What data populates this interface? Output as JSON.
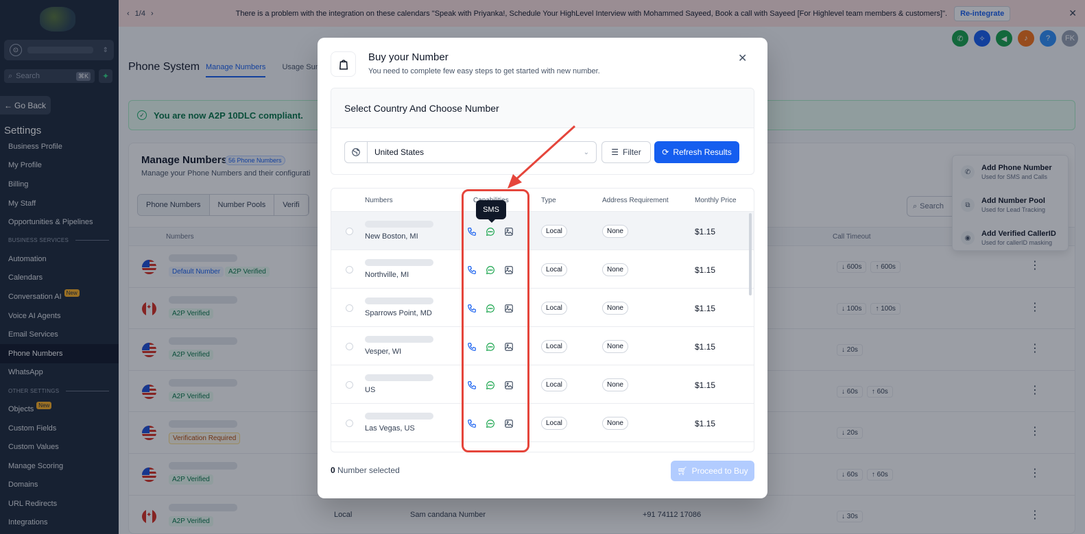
{
  "banner": {
    "pager": "1/4",
    "message": "There is a problem with the integration on these calendars \"Speak with Priyanka!, Schedule Your HighLevel Interview with Mohammed Sayeed, Book a call with Sayeed [For Highlevel team members & customers]\".",
    "button": "Re-integrate"
  },
  "sidebar": {
    "search_placeholder": "Search",
    "search_kbd": "⌘K",
    "go_back": "Go Back",
    "settings_title": "Settings",
    "items_a": [
      "Business Profile",
      "My Profile",
      "Billing",
      "My Staff",
      "Opportunities & Pipelines"
    ],
    "section_business": "BUSINESS SERVICES",
    "items_b": [
      "Automation",
      "Calendars",
      "Conversation AI",
      "Voice AI Agents",
      "Email Services",
      "Phone Numbers",
      "WhatsApp"
    ],
    "section_other": "OTHER SETTINGS",
    "items_c": [
      "Objects",
      "Custom Fields",
      "Custom Values",
      "Manage Scoring",
      "Domains",
      "URL Redirects",
      "Integrations"
    ],
    "new_badge": "New"
  },
  "page": {
    "title": "Phone System",
    "tabs": [
      "Manage Numbers",
      "Usage Sum"
    ],
    "compliant": "You are now A2P 10DLC compliant.",
    "card_title": "Manage Numbers",
    "count_badge": "56 Phone Numbers",
    "card_desc": "Manage your Phone Numbers and their configurati",
    "segments": [
      "Phone Numbers",
      "Number Pools",
      "Verifi"
    ],
    "search_placeholder": "Search",
    "col_numbers": "Numbers",
    "col_timeout": "Call Timeout",
    "tags": {
      "default": "Default Number",
      "a2p": "A2P Verified",
      "verification": "Verification Required"
    },
    "rows": [
      {
        "flag": "us",
        "tags": [
          "default",
          "a2p"
        ],
        "timeout": [
          "↓ 600s",
          "↑ 600s"
        ]
      },
      {
        "flag": "ca",
        "tags": [
          "a2p"
        ],
        "timeout": [
          "↓ 100s",
          "↑ 100s"
        ]
      },
      {
        "flag": "us",
        "tags": [
          "a2p"
        ],
        "timeout": [
          "↓ 20s"
        ]
      },
      {
        "flag": "us",
        "tags": [
          "a2p"
        ],
        "timeout": [
          "↓ 60s",
          "↑ 60s"
        ]
      },
      {
        "flag": "us",
        "tags": [
          "verification"
        ],
        "timeout": [
          "↓ 20s"
        ]
      },
      {
        "flag": "us",
        "tags": [
          "a2p"
        ],
        "timeout": [
          "↓ 60s",
          "↑ 60s"
        ]
      },
      {
        "flag": "ca",
        "tags": [
          "a2p"
        ],
        "timeout": [
          "↓ 30s"
        ],
        "type": "Local",
        "name": "Sam candana Number",
        "phone": "+91 74112 17086"
      }
    ]
  },
  "dropdown": [
    {
      "title": "Add Phone Number",
      "sub": "Used for SMS and Calls"
    },
    {
      "title": "Add Number Pool",
      "sub": "Used for Lead Tracking"
    },
    {
      "title": "Add Verified CallerID",
      "sub": "Used for callerID masking"
    }
  ],
  "topicons": {
    "avatar": "FK",
    "help": "?"
  },
  "modal": {
    "title": "Buy your Number",
    "subtitle": "You need to complete few easy steps to get started with new number.",
    "section_title": "Select Country And Choose Number",
    "country": "United States",
    "filter": "Filter",
    "refresh": "Refresh Results",
    "columns": {
      "numbers": "Numbers",
      "capabilities": "Capabilities",
      "type": "Type",
      "address": "Address Requirement",
      "price": "Monthly Price"
    },
    "rows": [
      {
        "location": "New Boston, MI",
        "type": "Local",
        "address": "None",
        "price": "$1.15"
      },
      {
        "location": "Northville, MI",
        "type": "Local",
        "address": "None",
        "price": "$1.15"
      },
      {
        "location": "Sparrows Point, MD",
        "type": "Local",
        "address": "None",
        "price": "$1.15"
      },
      {
        "location": "Vesper, WI",
        "type": "Local",
        "address": "None",
        "price": "$1.15"
      },
      {
        "location": "US",
        "type": "Local",
        "address": "None",
        "price": "$1.15"
      },
      {
        "location": "Las Vegas, US",
        "type": "Local",
        "address": "None",
        "price": "$1.15"
      }
    ],
    "selected_count": "0",
    "selected_label": "Number selected",
    "proceed": "Proceed to Buy",
    "tooltip": "SMS"
  },
  "colors": {
    "primary": "#155eef",
    "annotation": "#e5453b",
    "sidebar": "#1d2939"
  }
}
